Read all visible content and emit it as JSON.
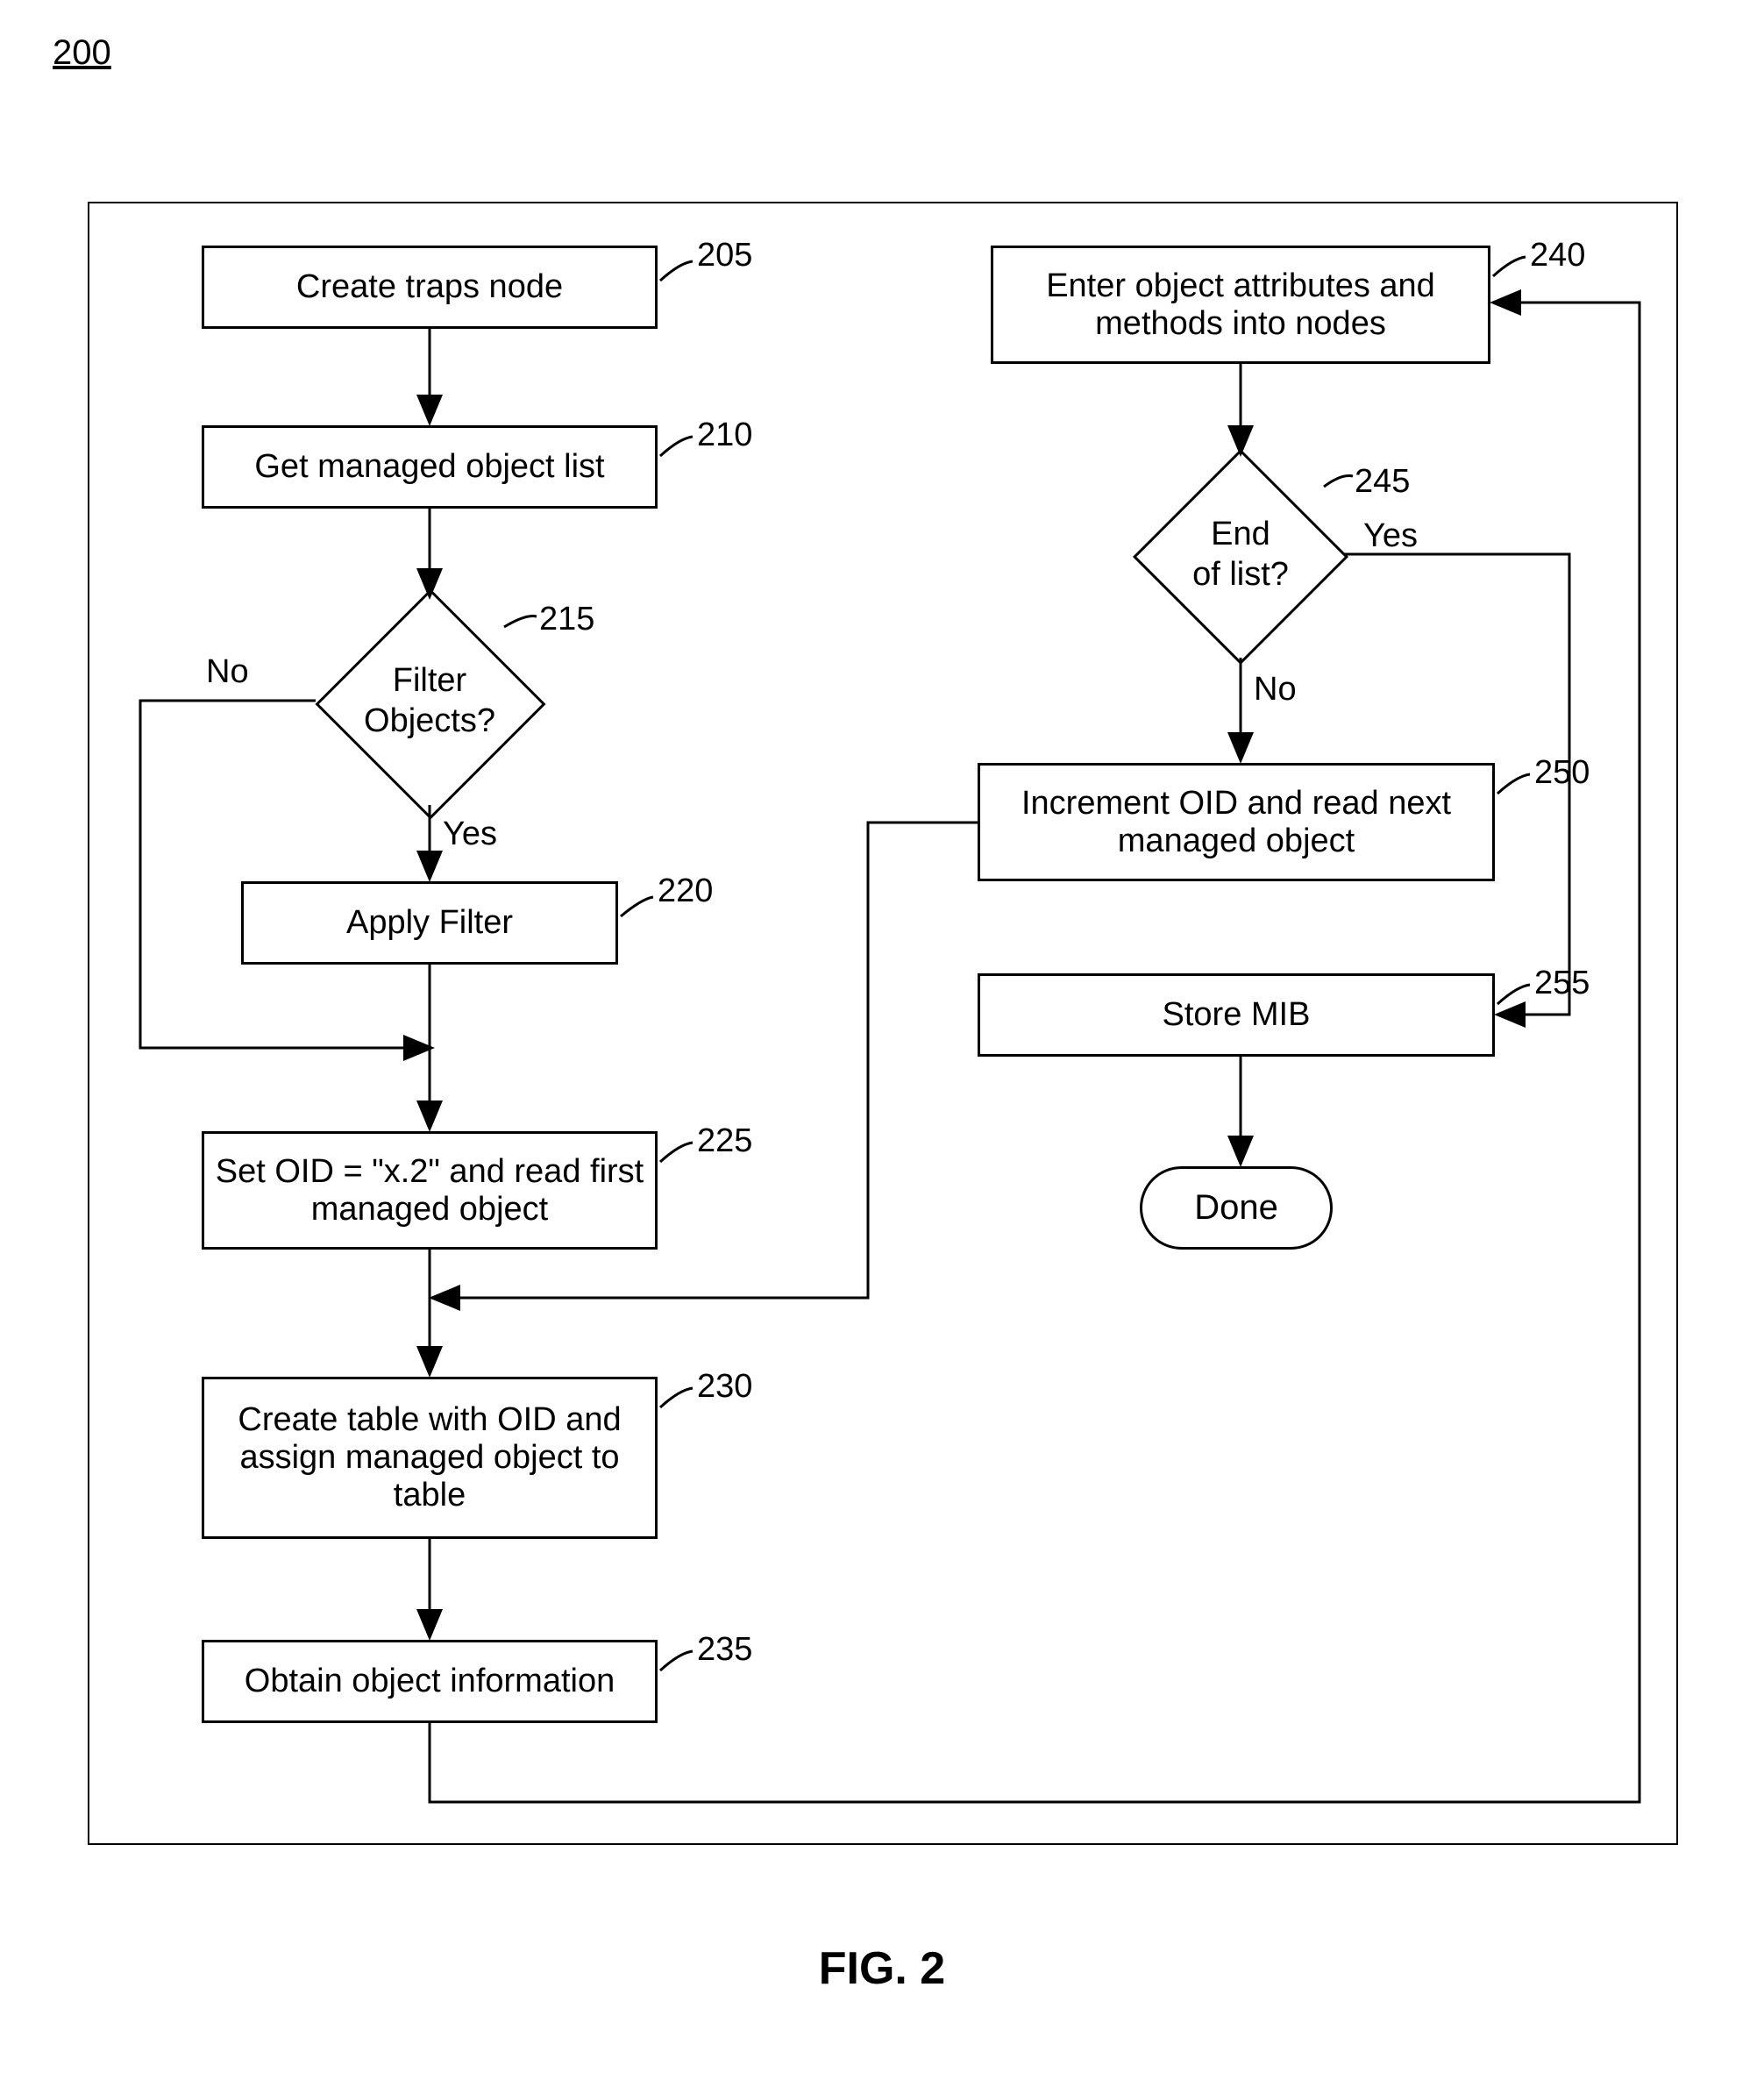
{
  "figure_ref": "200",
  "figure_title": "FIG. 2",
  "nodes": {
    "n205": {
      "text": "Create traps node",
      "ref": "205"
    },
    "n210": {
      "text": "Get managed object list",
      "ref": "210"
    },
    "n215": {
      "text": "Filter\nObjects?",
      "ref": "215",
      "yes": "Yes",
      "no": "No"
    },
    "n220": {
      "text": "Apply Filter",
      "ref": "220"
    },
    "n225": {
      "text": "Set OID = \"x.2\" and read first managed object",
      "ref": "225"
    },
    "n230": {
      "text": "Create table with OID and assign managed object to table",
      "ref": "230"
    },
    "n235": {
      "text": "Obtain object information",
      "ref": "235"
    },
    "n240": {
      "text": "Enter object attributes and methods into nodes",
      "ref": "240"
    },
    "n245": {
      "text": "End\nof list?",
      "ref": "245",
      "yes": "Yes",
      "no": "No"
    },
    "n250": {
      "text": "Increment OID and read next managed object",
      "ref": "250"
    },
    "n255": {
      "text": "Store MIB",
      "ref": "255"
    },
    "done": {
      "text": "Done"
    }
  }
}
